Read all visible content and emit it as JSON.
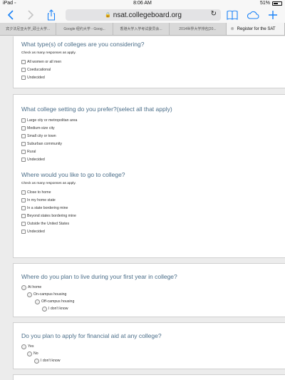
{
  "status_bar": {
    "device": "iPad",
    "time": "8:06 AM",
    "battery": "51%"
  },
  "toolbar": {
    "url": "nsat.collegeboard.org",
    "icons": [
      "back-icon",
      "forward-icon",
      "share-icon",
      "lock-icon",
      "reload-icon",
      "bookmarks-icon",
      "cloud-tabs-icon",
      "new-tab-icon"
    ]
  },
  "tabs": [
    {
      "label": "宾夕法尼亚大学_硕士大学..."
    },
    {
      "label": "Google 纽约大学 - Goog..."
    },
    {
      "label": "香港大学入学考试委员会..."
    },
    {
      "label": "2014世界大学排名[20..."
    },
    {
      "label": "Register for the SAT"
    }
  ],
  "questions": [
    {
      "title": "What type(s) of colleges are you considering?",
      "hint": "Check as many responses as apply.",
      "options": [
        {
          "label": "All women or all men"
        },
        {
          "label": "Coeducational"
        },
        {
          "label": "Undecided"
        }
      ]
    },
    {
      "title": "What college setting do you prefer?(select all that apply)",
      "options": [
        {
          "label": "Large city or metropolitan area"
        },
        {
          "label": "Medium-size city"
        },
        {
          "label": "Small city or town"
        },
        {
          "label": "Suburban community"
        },
        {
          "label": "Rural"
        },
        {
          "label": "Undecided"
        }
      ]
    },
    {
      "title": "Where would you like to go to college?",
      "hint": "Check as many responses as apply.",
      "options": [
        {
          "label": "Close to home"
        },
        {
          "label": "In my home state"
        },
        {
          "label": "In a state bordering mine"
        },
        {
          "label": "Beyond states bordering mine"
        },
        {
          "label": "Outside the United States"
        },
        {
          "label": "Undecided"
        }
      ]
    },
    {
      "title": "Where do you plan to live during your first year in college?",
      "options": [
        {
          "label": "At home"
        },
        {
          "label": "On-campus housing"
        },
        {
          "label": "Off-campus housing"
        },
        {
          "label": "I don't know"
        }
      ]
    },
    {
      "title": "Do you plan to apply for financial aid at any college?",
      "options": [
        {
          "label": "Yes"
        },
        {
          "label": "No"
        },
        {
          "label": "I don't know"
        }
      ]
    }
  ]
}
